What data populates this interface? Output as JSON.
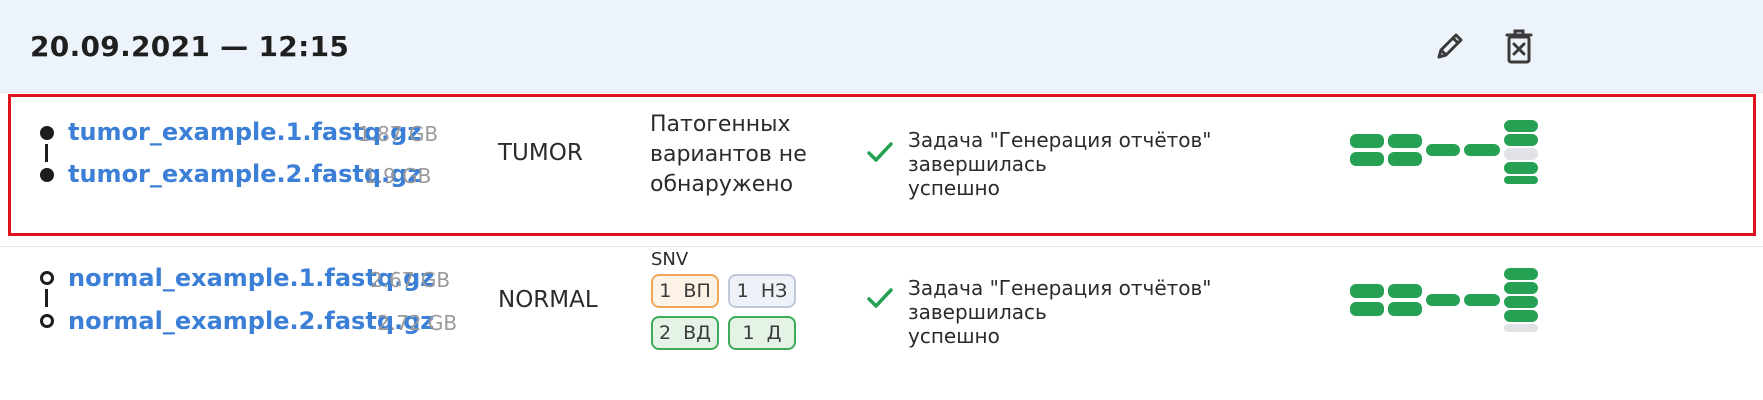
{
  "header": {
    "title": "20.09.2021 — 12:15",
    "edit_icon": "pencil-icon",
    "delete_icon": "trash-icon"
  },
  "colors": {
    "link": "#3b7fd6",
    "highlight": "#e0121b",
    "success": "#26a154",
    "header_bg": "#edf3fb"
  },
  "samples": [
    {
      "files": [
        {
          "name": "tumor_example.1.fastq.gz",
          "size": "1.87 GB"
        },
        {
          "name": "tumor_example.2.fastq.gz",
          "size": "1.9 GB"
        }
      ],
      "type": "TUMOR",
      "variants_text": [
        "Патогенных",
        "вариантов не",
        "обнаружено"
      ],
      "status_icon": "check-icon",
      "status": [
        "Задача \"Генерация отчётов\" завершилась",
        "успешно"
      ],
      "pipeline_icon": "pipeline-progress-icon"
    },
    {
      "files": [
        {
          "name": "normal_example.1.fastq.gz",
          "size": "2.67 GB"
        },
        {
          "name": "normal_example.2.fastq.gz",
          "size": "2.72 GB"
        }
      ],
      "type": "NORMAL",
      "variants_label": "SNV",
      "badges": [
        {
          "count": "1",
          "label": "ВП",
          "color": "orange"
        },
        {
          "count": "1",
          "label": "НЗ",
          "color": "blue"
        },
        {
          "count": "2",
          "label": "ВД",
          "color": "green"
        },
        {
          "count": "1",
          "label": "Д",
          "color": "green"
        }
      ],
      "status_icon": "check-icon",
      "status": [
        "Задача \"Генерация отчётов\" завершилась",
        "успешно"
      ],
      "pipeline_icon": "pipeline-progress-icon"
    }
  ]
}
